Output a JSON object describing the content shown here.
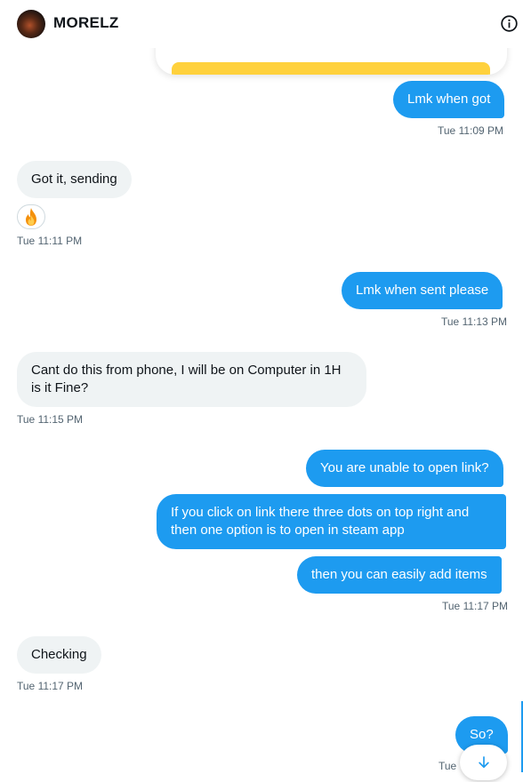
{
  "header": {
    "title": "MORELZ",
    "avatar_icon": "user-avatar",
    "info_icon": "info-icon"
  },
  "attachment": {
    "accent_color": "#ffd13c"
  },
  "messages": [
    {
      "direction": "out",
      "text": "Lmk when got"
    },
    {
      "direction": "in",
      "text": "Got it, sending",
      "reaction": "fire-emoji"
    },
    {
      "direction": "out",
      "text": "Lmk when sent please"
    },
    {
      "direction": "in",
      "text": "Cant do this from phone, I will be on Computer in 1H is it Fine?"
    },
    {
      "direction": "out",
      "text": "You are unable to open link?"
    },
    {
      "direction": "out",
      "text": "If you click on link there three dots on top right and then one option is to open in steam app"
    },
    {
      "direction": "out",
      "text": "then you can easily add items"
    },
    {
      "direction": "in",
      "text": "Checking"
    },
    {
      "direction": "out",
      "text": "So?"
    }
  ],
  "timestamps": [
    "Tue 11:09 PM",
    "Tue 11:11 PM",
    "Tue 11:13 PM",
    "Tue 11:15 PM",
    "Tue 11:17 PM",
    "Tue 11:17 PM",
    "Tue"
  ],
  "scroll_button": {
    "icon": "arrow-down-icon"
  },
  "colors": {
    "outgoing_bubble": "#1d9bf0",
    "incoming_bubble": "#eff3f4",
    "timestamp_text": "#536471"
  }
}
